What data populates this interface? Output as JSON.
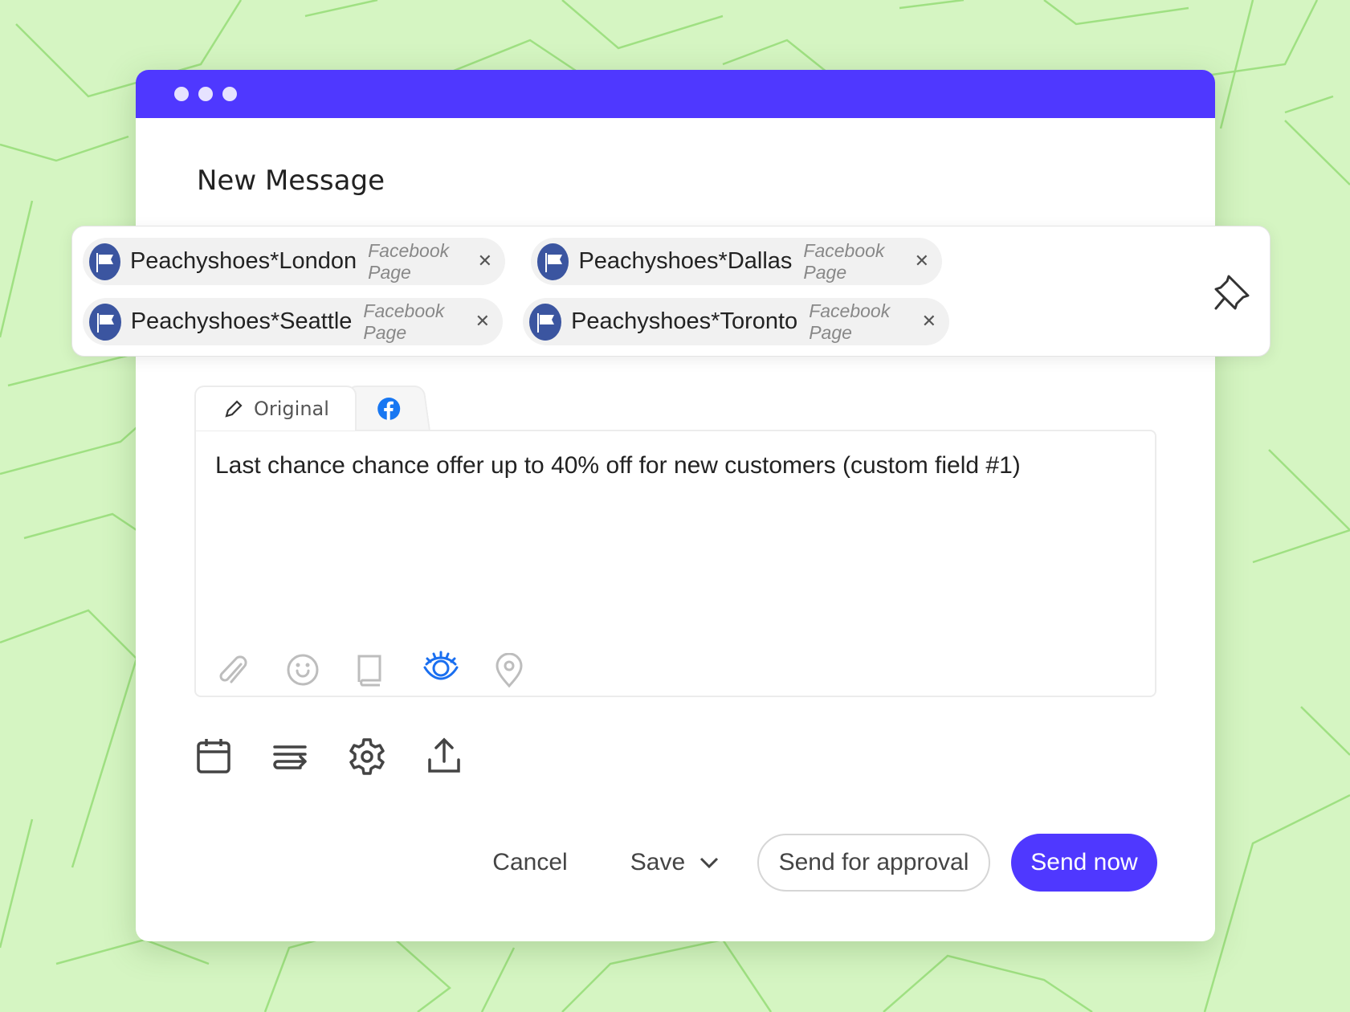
{
  "window": {
    "title": "New Message"
  },
  "recipients": [
    {
      "name": "Peachyshoes*London",
      "type": "Facebook Page"
    },
    {
      "name": "Peachyshoes*Dallas",
      "type": "Facebook Page"
    },
    {
      "name": "Peachyshoes*Seattle",
      "type": "Facebook Page"
    },
    {
      "name": "Peachyshoes*Toronto",
      "type": "Facebook Page"
    }
  ],
  "tabs": {
    "original": "Original",
    "facebook_icon": "facebook-icon"
  },
  "editor": {
    "text": "Last chance chance offer up to 40% off for new customers (custom field #1)"
  },
  "editor_tools": [
    "paperclip-icon",
    "smiley-icon",
    "book-icon",
    "eye-icon",
    "location-pin-icon"
  ],
  "actions_icons": [
    "calendar-icon",
    "queue-icon",
    "gear-icon",
    "upload-icon"
  ],
  "buttons": {
    "cancel": "Cancel",
    "save": "Save",
    "approval": "Send for approval",
    "send": "Send now"
  },
  "colors": {
    "brand": "#4f38ff",
    "facebook": "#1877f2",
    "active_tool": "#1a6ff0"
  }
}
